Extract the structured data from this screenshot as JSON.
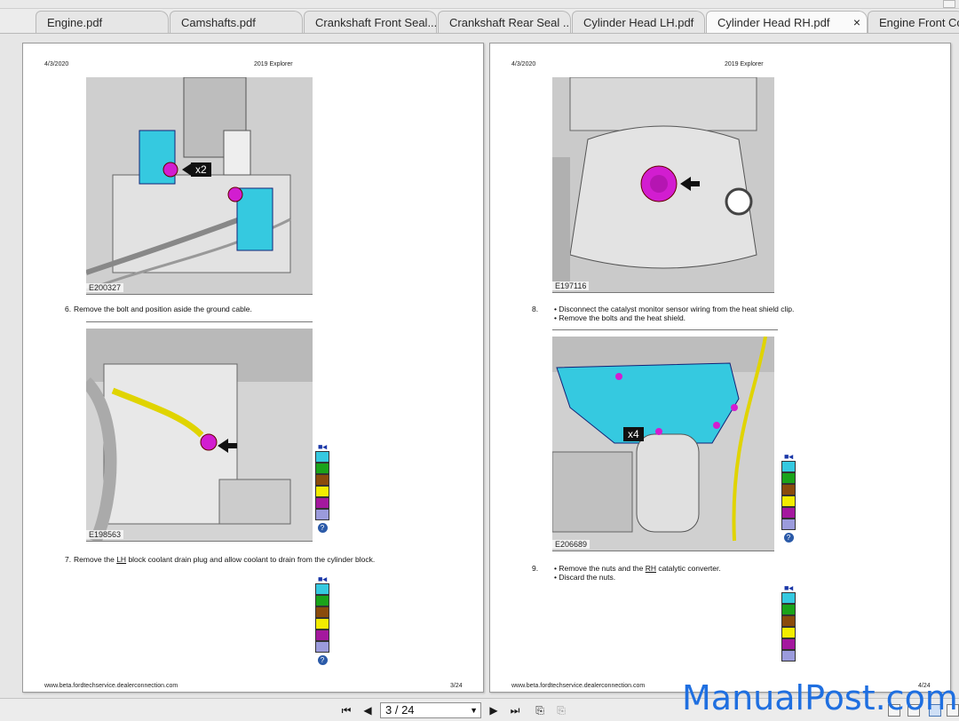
{
  "tabs": [
    {
      "label": "Engine.pdf",
      "active": false
    },
    {
      "label": "Camshafts.pdf",
      "active": false
    },
    {
      "label": "Crankshaft Front Seal....",
      "active": false
    },
    {
      "label": "Crankshaft Rear Seal ...",
      "active": false
    },
    {
      "label": "Cylinder Head LH.pdf",
      "active": false
    },
    {
      "label": "Cylinder Head RH.pdf",
      "active": true,
      "close": "×"
    },
    {
      "label": "Engine Front Cov",
      "active": false
    }
  ],
  "left_page": {
    "date": "4/3/2020",
    "title": "2019 Explorer",
    "fig1_code": "E200327",
    "fig1_callout": "x2",
    "step6_num": "6.",
    "step6_text": "Remove the bolt and position aside the ground cable.",
    "fig2_code": "E198563",
    "step7_num": "7.",
    "step7_pre": "Remove the ",
    "step7_lh": "LH",
    "step7_post": " block coolant drain plug and allow coolant to drain from the cylinder block.",
    "footer_url": "www.beta.fordtechservice.dealerconnection.com",
    "page_num": "3/24"
  },
  "right_page": {
    "date": "4/3/2020",
    "title": "2019 Explorer",
    "fig1_code": "E197116",
    "step8_num": "8.",
    "step8_b1": "Disconnect the catalyst monitor sensor wiring from the heat shield clip.",
    "step8_b2": "Remove the bolts and the heat shield.",
    "fig2_code": "E206689",
    "fig2_callout": "x4",
    "step9_num": "9.",
    "step9_b1_pre": "Remove the nuts and the ",
    "step9_b1_rh": "RH",
    "step9_b1_post": " catalytic converter.",
    "step9_b2": "Discard the nuts.",
    "footer_url": "www.beta.fordtechservice.dealerconnection.com",
    "page_num": "4/24"
  },
  "legend_colors": [
    "#35c9e0",
    "#1aa31a",
    "#8a4b0c",
    "#f2ec00",
    "#a4189e",
    "#9b9bdc"
  ],
  "nav": {
    "first": "⏮",
    "prev": "◀",
    "page_value": "3 / 24",
    "next": "▶",
    "last": "⏭"
  },
  "watermark": "ManualPost.com"
}
